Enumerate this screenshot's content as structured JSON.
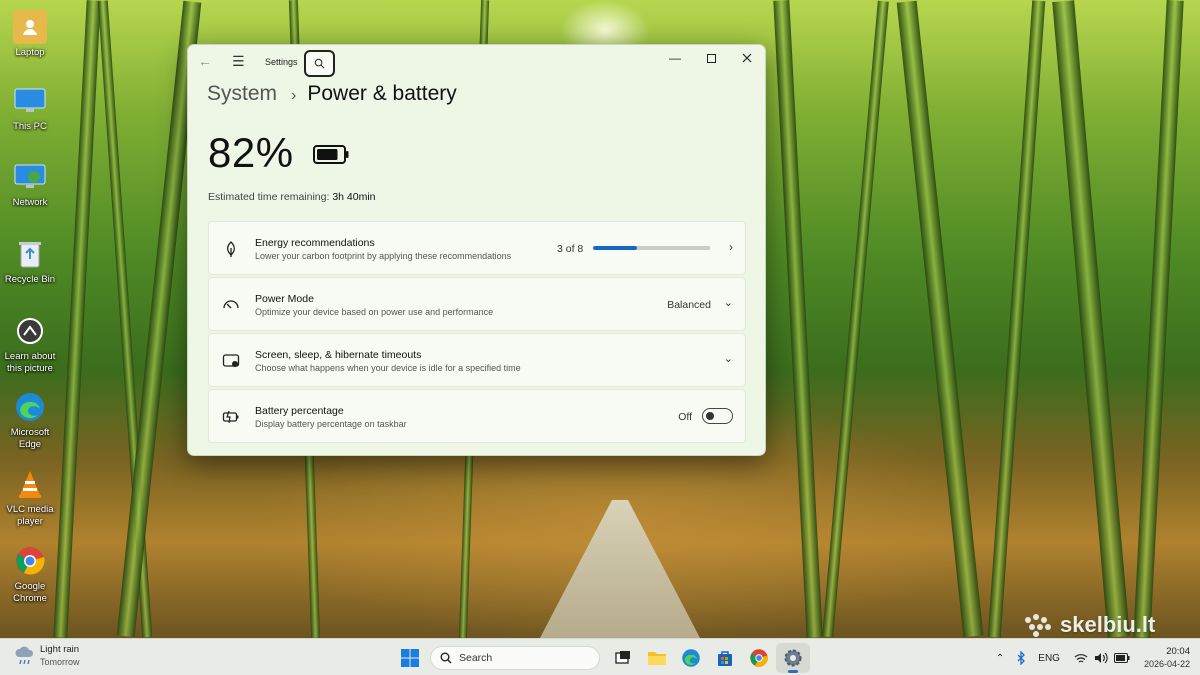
{
  "desktop": {
    "icons": [
      {
        "label": "Laptop"
      },
      {
        "label": "This PC"
      },
      {
        "label": "Network"
      },
      {
        "label": "Recycle Bin"
      },
      {
        "label": "Learn about this picture"
      },
      {
        "label": "Microsoft Edge"
      },
      {
        "label": "VLC media player"
      },
      {
        "label": "Google Chrome"
      }
    ]
  },
  "window": {
    "app_title": "Settings",
    "breadcrumb": {
      "parent": "System",
      "separator": "›",
      "current": "Power & battery"
    },
    "battery": {
      "percent_label": "82%",
      "level": 0.82
    },
    "estimate": {
      "label": "Estimated time remaining:",
      "value": "3h 40min"
    },
    "cards": {
      "energy": {
        "title": "Energy recommendations",
        "subtitle": "Lower your carbon footprint by applying these recommendations",
        "progress_label": "3 of 8",
        "progress_fraction": 0.375
      },
      "power_mode": {
        "title": "Power Mode",
        "subtitle": "Optimize your device based on power use and performance",
        "value": "Balanced"
      },
      "timeouts": {
        "title": "Screen, sleep, & hibernate timeouts",
        "subtitle": "Choose what happens when your device is idle for a specified time"
      },
      "battery_pct": {
        "title": "Battery percentage",
        "subtitle": "Display battery percentage on taskbar",
        "state": "Off"
      }
    }
  },
  "taskbar": {
    "weather": {
      "line1": "Light rain",
      "line2": "Tomorrow"
    },
    "search_placeholder": "Search",
    "tray": {
      "language": "ENG",
      "time": "20:04",
      "date": "2026-04-22"
    }
  },
  "watermark": {
    "text": "skelbiu.lt"
  },
  "colors": {
    "accent": "#1568c4",
    "window_bg": "#eef6e6",
    "card_bg": "#f7fbf3"
  }
}
